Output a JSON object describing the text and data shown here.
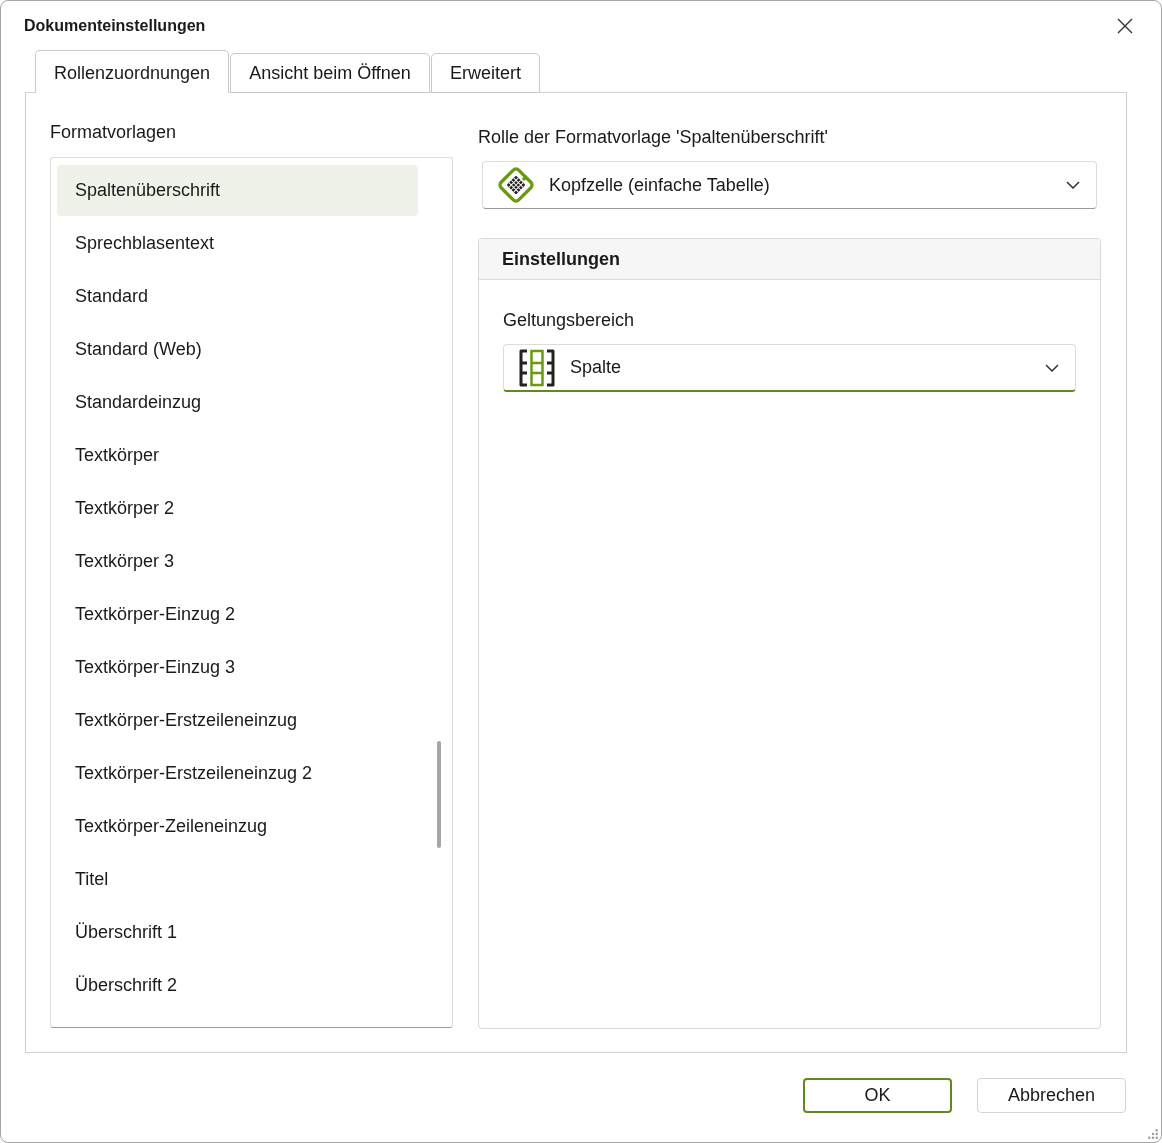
{
  "window": {
    "title": "Dokumenteinstellungen"
  },
  "tabs": [
    {
      "label": "Rollenzuordnungen",
      "selected": true
    },
    {
      "label": "Ansicht beim Öffnen",
      "selected": false
    },
    {
      "label": "Erweitert",
      "selected": false
    }
  ],
  "styles": {
    "label": "Formatvorlagen",
    "items": [
      {
        "label": "Spaltenüberschrift",
        "selected": true
      },
      {
        "label": "Sprechblasentext",
        "selected": false
      },
      {
        "label": "Standard",
        "selected": false
      },
      {
        "label": "Standard (Web)",
        "selected": false
      },
      {
        "label": "Standardeinzug",
        "selected": false
      },
      {
        "label": "Textkörper",
        "selected": false
      },
      {
        "label": "Textkörper 2",
        "selected": false
      },
      {
        "label": "Textkörper 3",
        "selected": false
      },
      {
        "label": "Textkörper-Einzug 2",
        "selected": false
      },
      {
        "label": "Textkörper-Einzug 3",
        "selected": false
      },
      {
        "label": "Textkörper-Erstzeileneinzug",
        "selected": false
      },
      {
        "label": "Textkörper-Erstzeileneinzug 2",
        "selected": false
      },
      {
        "label": "Textkörper-Zeileneinzug",
        "selected": false
      },
      {
        "label": "Titel",
        "selected": false
      },
      {
        "label": "Überschrift 1",
        "selected": false
      },
      {
        "label": "Überschrift 2",
        "selected": false
      }
    ]
  },
  "role": {
    "label": "Rolle der Formatvorlage 'Spaltenüberschrift'",
    "value": "Kopfzelle (einfache Tabelle)"
  },
  "settings": {
    "title": "Einstellungen",
    "scope": {
      "label": "Geltungsbereich",
      "value": "Spalte",
      "focused": true
    }
  },
  "buttons": [
    {
      "label": "OK",
      "default": true
    },
    {
      "label": "Abbrechen",
      "default": false
    }
  ]
}
